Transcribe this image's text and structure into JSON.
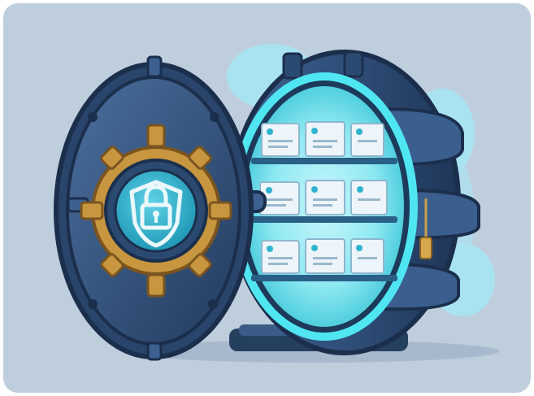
{
  "illustration": {
    "subject": "vault",
    "icon": "padlock-shield-icon",
    "colors": {
      "background": "#bfcedd",
      "blob": "#a9e3f2",
      "vault_body": "#2f4f79",
      "vault_dark": "#1f3658",
      "vault_mid": "#3c6190",
      "vault_light": "#5c86b5",
      "glow": "#4fe6f2",
      "brass": "#c8963f",
      "emblem": "#2fb3cf",
      "document": "#eef5fa"
    }
  }
}
